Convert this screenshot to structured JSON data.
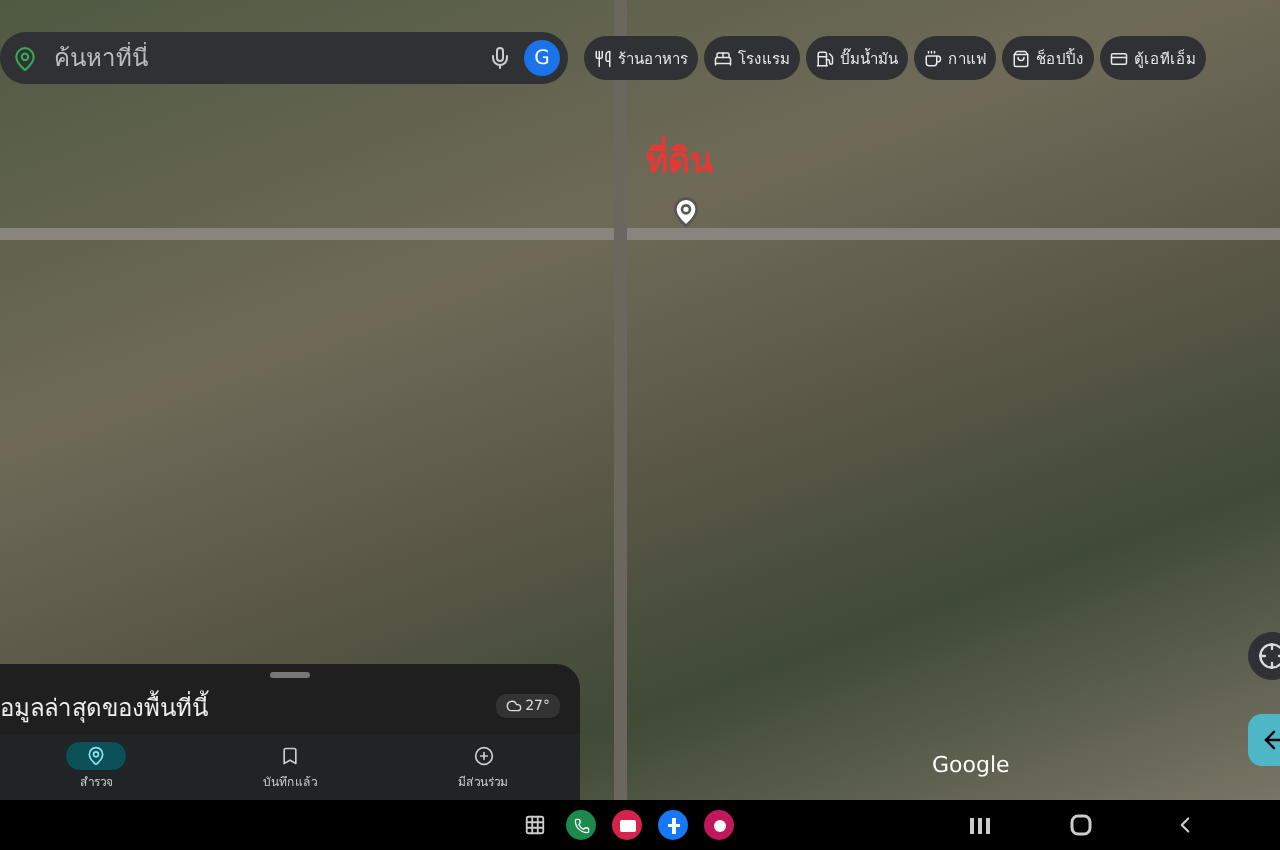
{
  "search": {
    "placeholder": "ค้นหาที่นี่",
    "account_initial": "G"
  },
  "chips": [
    {
      "label": "ร้านอาหาร",
      "kind": "food"
    },
    {
      "label": "โรงแรม",
      "kind": "hotel"
    },
    {
      "label": "ปั๊มน้ำมัน",
      "kind": "gas"
    },
    {
      "label": "กาแฟ",
      "kind": "coffee"
    },
    {
      "label": "ช็อปปิ้ง",
      "kind": "shopping"
    },
    {
      "label": "ตู้เอทีเอ็ม",
      "kind": "atm"
    }
  ],
  "map": {
    "annotation": "ที่ดิน",
    "attribution": "Google"
  },
  "sheet": {
    "title": "อมูลล่าสุดของพื้นที่นี้",
    "temperature": "27°"
  },
  "nav": [
    {
      "label": "สำรวจ",
      "kind": "explore",
      "selected": true
    },
    {
      "label": "บันทึกแล้ว",
      "kind": "saved",
      "selected": false
    },
    {
      "label": "มีส่วนร่วม",
      "kind": "contribute",
      "selected": false
    }
  ]
}
